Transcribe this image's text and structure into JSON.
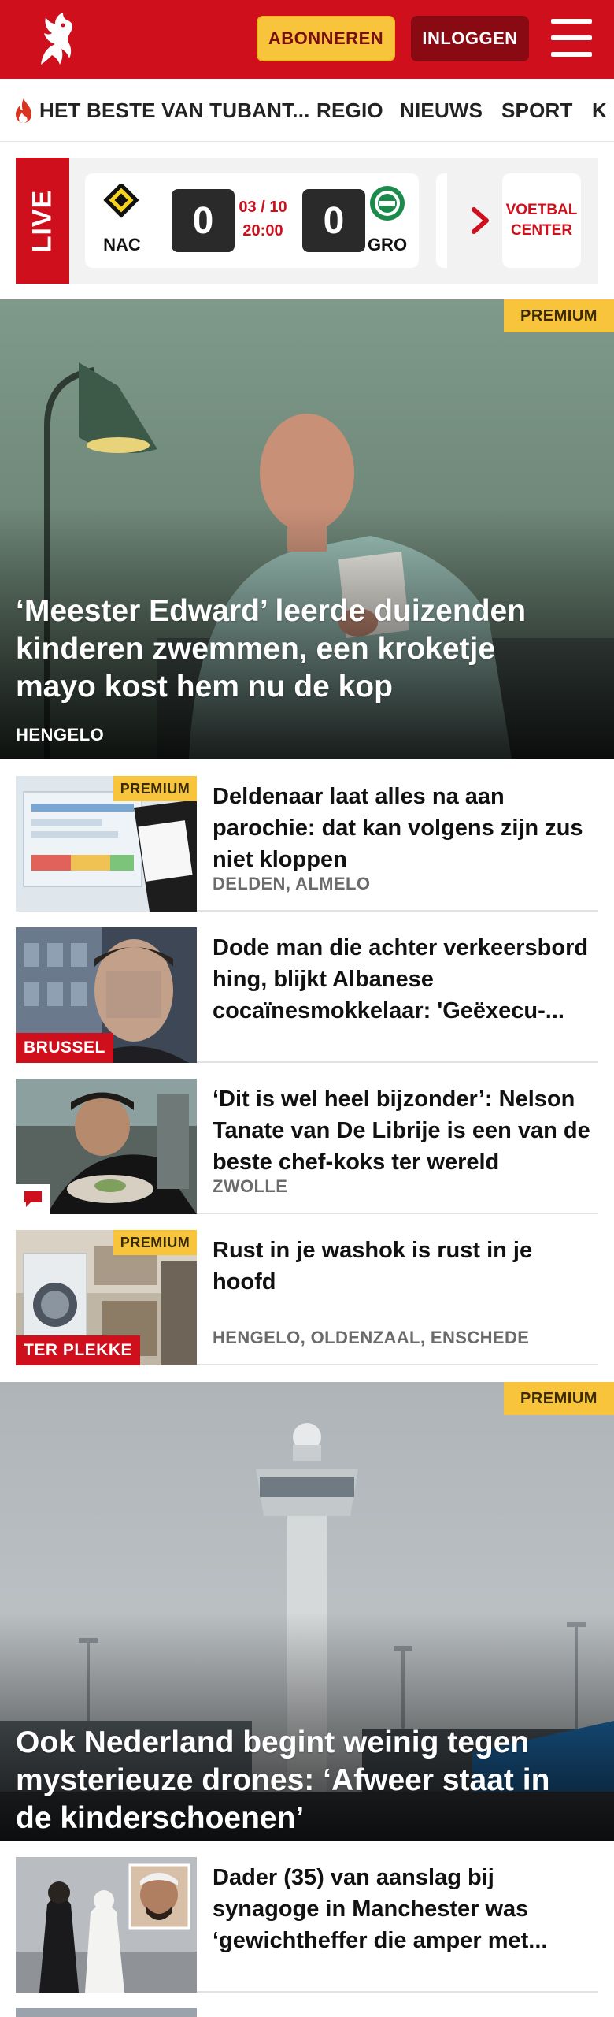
{
  "header": {
    "logo_icon": "tubantia-horse-logo",
    "subscribe_label": "ABONNEREN",
    "login_label": "INLOGGEN",
    "menu_icon": "hamburger-menu-icon",
    "brand_color": "#cf0f1c",
    "accent_color": "#f7c43c"
  },
  "nav": {
    "items": [
      {
        "label": "HET BESTE VAN TUBANT...",
        "icon": "flame-icon"
      },
      {
        "label": "REGIO"
      },
      {
        "label": "NIEUWS"
      },
      {
        "label": "SPORT"
      },
      {
        "label": "K"
      }
    ]
  },
  "live": {
    "tag": "LIVE",
    "match": {
      "home": "NAC",
      "away": "GRO",
      "home_score": "0",
      "away_score": "0",
      "date": "03 / 10",
      "time": "20:00"
    },
    "voetbal_center": "VOETBAL CENTER"
  },
  "articles": [
    {
      "type": "hero",
      "premium": "PREMIUM",
      "title": "‘Meester Edward’ leerde duizenden kinderen zwemmen, een kroketje mayo kost hem nu de kop",
      "location": "HENGELO"
    },
    {
      "type": "list",
      "premium": "PREMIUM",
      "title": "Deldenaar laat alles na aan parochie: dat kan volgens zijn zus niet kloppen",
      "location": "DELDEN, ALMELO"
    },
    {
      "type": "list",
      "tag": "BRUSSEL",
      "title": "Dode man die achter verkeers­bord hing, blijkt Albanese cocaïnesmokkelaar: 'Geëxecu-...",
      "location": ""
    },
    {
      "type": "list",
      "comment_icon": "comment-icon",
      "title": "‘Dit is wel heel bijzonder’: Nelson Tanate van De Librije is een van de beste chef-koks ter wereld",
      "location": "ZWOLLE"
    },
    {
      "type": "list",
      "premium": "PREMIUM",
      "tag": "TER PLEKKE",
      "title": "Rust in je washok is rust in je hoofd",
      "location": "HENGELO, OLDENZAAL, ENSCHEDE"
    },
    {
      "type": "hero",
      "premium": "PREMIUM",
      "title": "Ook Nederland begint weinig tegen mysterieuze drones: ‘Afweer staat in de kinderschoenen’",
      "location": ""
    },
    {
      "type": "list",
      "title": "Dader (35) van aanslag bij synagoge in Manchester was ‘gewichtheffer die amper met...",
      "location": ""
    }
  ]
}
